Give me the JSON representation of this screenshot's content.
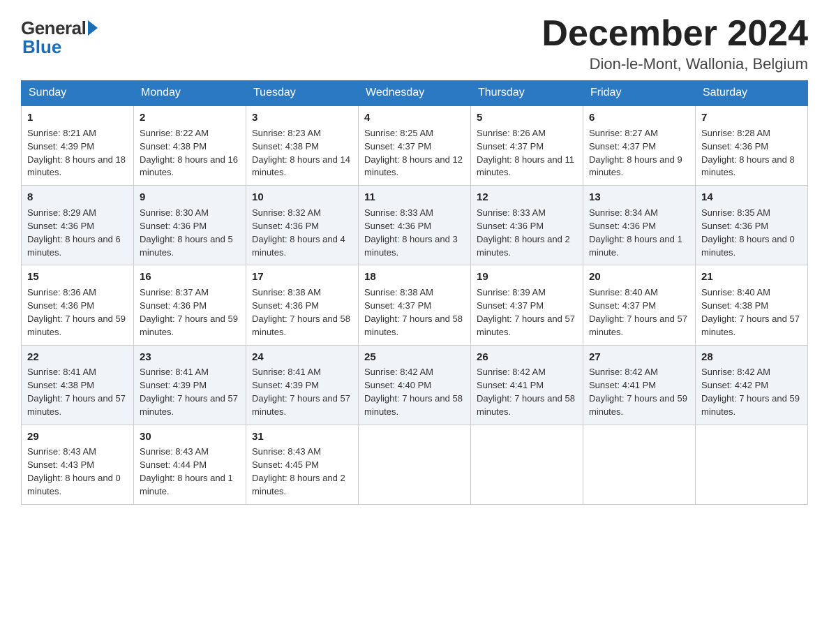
{
  "header": {
    "logo_general": "General",
    "logo_blue": "Blue",
    "month_title": "December 2024",
    "location": "Dion-le-Mont, Wallonia, Belgium"
  },
  "weekdays": [
    "Sunday",
    "Monday",
    "Tuesday",
    "Wednesday",
    "Thursday",
    "Friday",
    "Saturday"
  ],
  "weeks": [
    [
      {
        "day": "1",
        "sunrise": "8:21 AM",
        "sunset": "4:39 PM",
        "daylight": "8 hours and 18 minutes."
      },
      {
        "day": "2",
        "sunrise": "8:22 AM",
        "sunset": "4:38 PM",
        "daylight": "8 hours and 16 minutes."
      },
      {
        "day": "3",
        "sunrise": "8:23 AM",
        "sunset": "4:38 PM",
        "daylight": "8 hours and 14 minutes."
      },
      {
        "day": "4",
        "sunrise": "8:25 AM",
        "sunset": "4:37 PM",
        "daylight": "8 hours and 12 minutes."
      },
      {
        "day": "5",
        "sunrise": "8:26 AM",
        "sunset": "4:37 PM",
        "daylight": "8 hours and 11 minutes."
      },
      {
        "day": "6",
        "sunrise": "8:27 AM",
        "sunset": "4:37 PM",
        "daylight": "8 hours and 9 minutes."
      },
      {
        "day": "7",
        "sunrise": "8:28 AM",
        "sunset": "4:36 PM",
        "daylight": "8 hours and 8 minutes."
      }
    ],
    [
      {
        "day": "8",
        "sunrise": "8:29 AM",
        "sunset": "4:36 PM",
        "daylight": "8 hours and 6 minutes."
      },
      {
        "day": "9",
        "sunrise": "8:30 AM",
        "sunset": "4:36 PM",
        "daylight": "8 hours and 5 minutes."
      },
      {
        "day": "10",
        "sunrise": "8:32 AM",
        "sunset": "4:36 PM",
        "daylight": "8 hours and 4 minutes."
      },
      {
        "day": "11",
        "sunrise": "8:33 AM",
        "sunset": "4:36 PM",
        "daylight": "8 hours and 3 minutes."
      },
      {
        "day": "12",
        "sunrise": "8:33 AM",
        "sunset": "4:36 PM",
        "daylight": "8 hours and 2 minutes."
      },
      {
        "day": "13",
        "sunrise": "8:34 AM",
        "sunset": "4:36 PM",
        "daylight": "8 hours and 1 minute."
      },
      {
        "day": "14",
        "sunrise": "8:35 AM",
        "sunset": "4:36 PM",
        "daylight": "8 hours and 0 minutes."
      }
    ],
    [
      {
        "day": "15",
        "sunrise": "8:36 AM",
        "sunset": "4:36 PM",
        "daylight": "7 hours and 59 minutes."
      },
      {
        "day": "16",
        "sunrise": "8:37 AM",
        "sunset": "4:36 PM",
        "daylight": "7 hours and 59 minutes."
      },
      {
        "day": "17",
        "sunrise": "8:38 AM",
        "sunset": "4:36 PM",
        "daylight": "7 hours and 58 minutes."
      },
      {
        "day": "18",
        "sunrise": "8:38 AM",
        "sunset": "4:37 PM",
        "daylight": "7 hours and 58 minutes."
      },
      {
        "day": "19",
        "sunrise": "8:39 AM",
        "sunset": "4:37 PM",
        "daylight": "7 hours and 57 minutes."
      },
      {
        "day": "20",
        "sunrise": "8:40 AM",
        "sunset": "4:37 PM",
        "daylight": "7 hours and 57 minutes."
      },
      {
        "day": "21",
        "sunrise": "8:40 AM",
        "sunset": "4:38 PM",
        "daylight": "7 hours and 57 minutes."
      }
    ],
    [
      {
        "day": "22",
        "sunrise": "8:41 AM",
        "sunset": "4:38 PM",
        "daylight": "7 hours and 57 minutes."
      },
      {
        "day": "23",
        "sunrise": "8:41 AM",
        "sunset": "4:39 PM",
        "daylight": "7 hours and 57 minutes."
      },
      {
        "day": "24",
        "sunrise": "8:41 AM",
        "sunset": "4:39 PM",
        "daylight": "7 hours and 57 minutes."
      },
      {
        "day": "25",
        "sunrise": "8:42 AM",
        "sunset": "4:40 PM",
        "daylight": "7 hours and 58 minutes."
      },
      {
        "day": "26",
        "sunrise": "8:42 AM",
        "sunset": "4:41 PM",
        "daylight": "7 hours and 58 minutes."
      },
      {
        "day": "27",
        "sunrise": "8:42 AM",
        "sunset": "4:41 PM",
        "daylight": "7 hours and 59 minutes."
      },
      {
        "day": "28",
        "sunrise": "8:42 AM",
        "sunset": "4:42 PM",
        "daylight": "7 hours and 59 minutes."
      }
    ],
    [
      {
        "day": "29",
        "sunrise": "8:43 AM",
        "sunset": "4:43 PM",
        "daylight": "8 hours and 0 minutes."
      },
      {
        "day": "30",
        "sunrise": "8:43 AM",
        "sunset": "4:44 PM",
        "daylight": "8 hours and 1 minute."
      },
      {
        "day": "31",
        "sunrise": "8:43 AM",
        "sunset": "4:45 PM",
        "daylight": "8 hours and 2 minutes."
      },
      null,
      null,
      null,
      null
    ]
  ],
  "labels": {
    "sunrise": "Sunrise:",
    "sunset": "Sunset:",
    "daylight": "Daylight:"
  }
}
